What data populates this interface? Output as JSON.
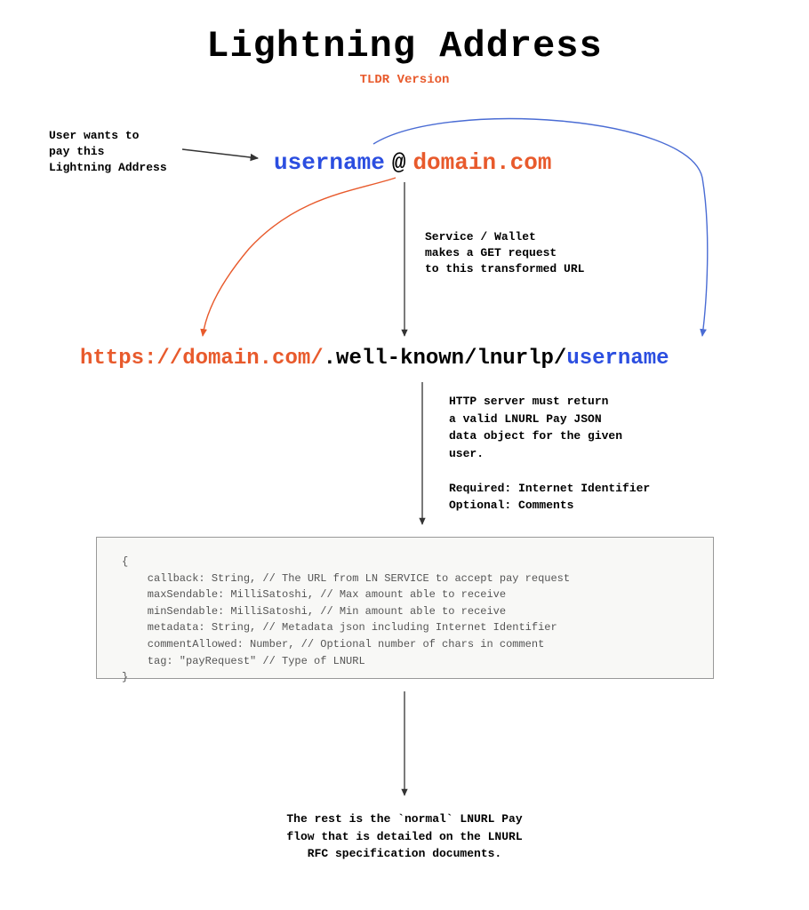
{
  "title": "Lightning Address",
  "subtitle": "TLDR Version",
  "user_wants_label": "User wants to\npay this\nLightning Address",
  "address": {
    "username": "username",
    "at": "@",
    "domain": "domain.com"
  },
  "get_request_label": "Service / Wallet\nmakes a GET request\nto this transformed URL",
  "url": {
    "scheme": "https://domain.com/",
    "path": ".well-known/lnurlp/",
    "username": "username"
  },
  "server_return_label": "HTTP server must return\na valid LNURL Pay JSON\ndata object for the given\nuser.\n\nRequired: Internet Identifier\nOptional: Comments",
  "code_block": "{\n    callback: String, // The URL from LN SERVICE to accept pay request\n    maxSendable: MilliSatoshi, // Max amount able to receive\n    minSendable: MilliSatoshi, // Min amount able to receive\n    metadata: String, // Metadata json including Internet Identifier\n    commentAllowed: Number, // Optional number of chars in comment\n    tag: \"payRequest\" // Type of LNURL\n}",
  "footer_label": "The rest is the `normal` LNURL Pay\nflow that is detailed on the LNURL\nRFC specification documents.",
  "colors": {
    "orange": "#e85a2c",
    "blue": "#2b4ee0",
    "black": "#000000",
    "gray": "#555555"
  }
}
